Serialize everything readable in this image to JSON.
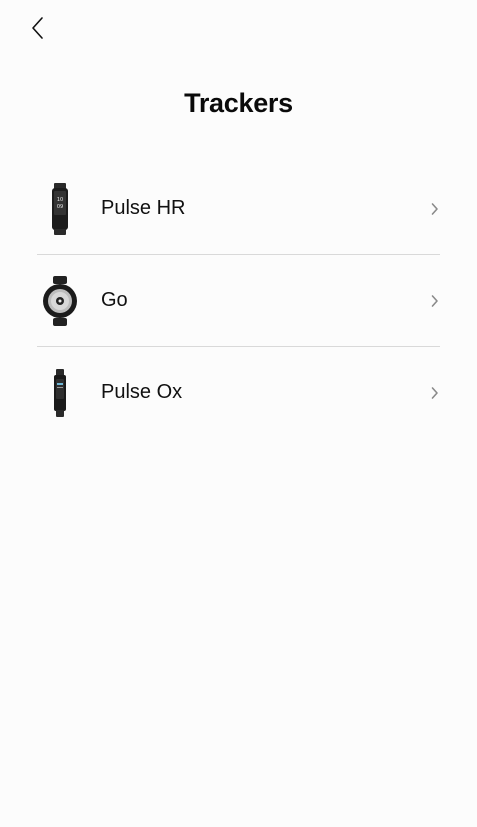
{
  "header": {
    "back_icon": "chevron-left-icon",
    "title": "Trackers"
  },
  "trackers": [
    {
      "label": "Pulse HR",
      "icon": "wristband-tracker-icon",
      "screen_text": "10 09"
    },
    {
      "label": "Go",
      "icon": "round-tracker-icon"
    },
    {
      "label": "Pulse Ox",
      "icon": "slim-band-tracker-icon"
    }
  ],
  "colors": {
    "background": "#fcfcfc",
    "divider": "#d9d9d9",
    "chevron": "#8a8a8a"
  }
}
